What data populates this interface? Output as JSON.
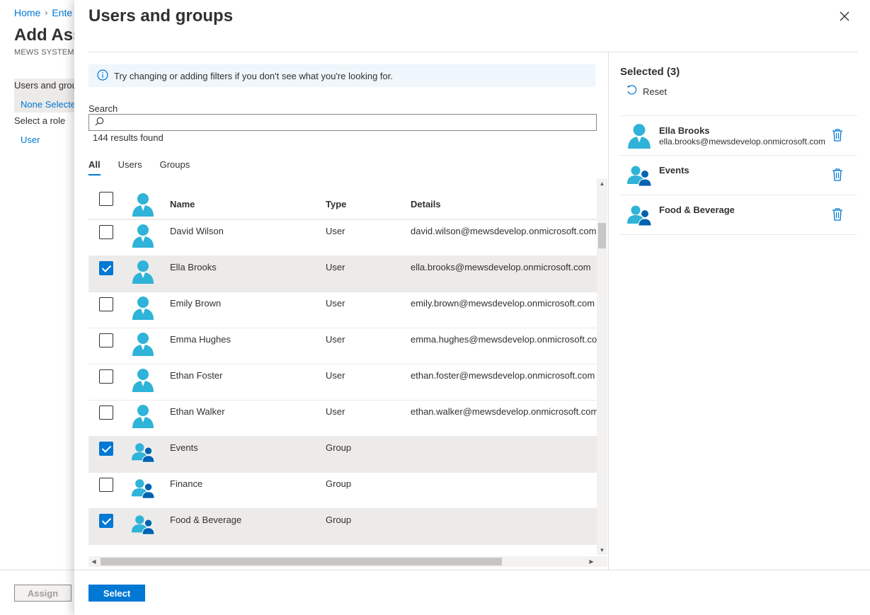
{
  "background": {
    "breadcrumb": {
      "home": "Home",
      "enterprise": "Ente"
    },
    "title": "Add Ass",
    "subtitle": "MEWS SYSTEMS",
    "section_label": "Users and grou",
    "section_value": "None Selecte",
    "role_label": "Select a role",
    "role_value": "User",
    "assign_label": "Assign"
  },
  "panel": {
    "title": "Users and groups",
    "info_text": "Try changing or adding filters if you don't see what you're looking for.",
    "search_label": "Search",
    "search_value": "",
    "results": "144 results found",
    "tabs": [
      "All",
      "Users",
      "Groups"
    ],
    "active_tab": "All",
    "columns": {
      "name": "Name",
      "type": "Type",
      "details": "Details"
    },
    "rows": [
      {
        "name": "David Wilson",
        "type": "User",
        "details": "david.wilson@mewsdevelop.onmicrosoft.com",
        "checked": false,
        "kind": "user"
      },
      {
        "name": "Ella Brooks",
        "type": "User",
        "details": "ella.brooks@mewsdevelop.onmicrosoft.com",
        "checked": true,
        "kind": "user"
      },
      {
        "name": "Emily Brown",
        "type": "User",
        "details": "emily.brown@mewsdevelop.onmicrosoft.com",
        "checked": false,
        "kind": "user"
      },
      {
        "name": "Emma Hughes",
        "type": "User",
        "details": "emma.hughes@mewsdevelop.onmicrosoft.com",
        "checked": false,
        "kind": "user"
      },
      {
        "name": "Ethan Foster",
        "type": "User",
        "details": "ethan.foster@mewsdevelop.onmicrosoft.com",
        "checked": false,
        "kind": "user"
      },
      {
        "name": "Ethan Walker",
        "type": "User",
        "details": "ethan.walker@mewsdevelop.onmicrosoft.com",
        "checked": false,
        "kind": "user"
      },
      {
        "name": "Events",
        "type": "Group",
        "details": "",
        "checked": true,
        "kind": "group"
      },
      {
        "name": "Finance",
        "type": "Group",
        "details": "",
        "checked": false,
        "kind": "group"
      },
      {
        "name": "Food & Beverage",
        "type": "Group",
        "details": "",
        "checked": true,
        "kind": "group"
      }
    ],
    "selected_title": "Selected (3)",
    "reset_label": "Reset",
    "selected": [
      {
        "name": "Ella Brooks",
        "email": "ella.brooks@mewsdevelop.onmicrosoft.com",
        "kind": "user"
      },
      {
        "name": "Events",
        "email": "",
        "kind": "group"
      },
      {
        "name": "Food & Beverage",
        "email": "",
        "kind": "group"
      }
    ],
    "select_label": "Select"
  },
  "colors": {
    "accent": "#0078d4",
    "user_icon": "#2fb3d8",
    "group_icon_dark": "#0063b1"
  },
  "icons": [
    "chevron-right-icon",
    "close-icon",
    "info-icon",
    "search-icon",
    "user-icon",
    "group-icon",
    "reset-icon",
    "trash-icon"
  ]
}
